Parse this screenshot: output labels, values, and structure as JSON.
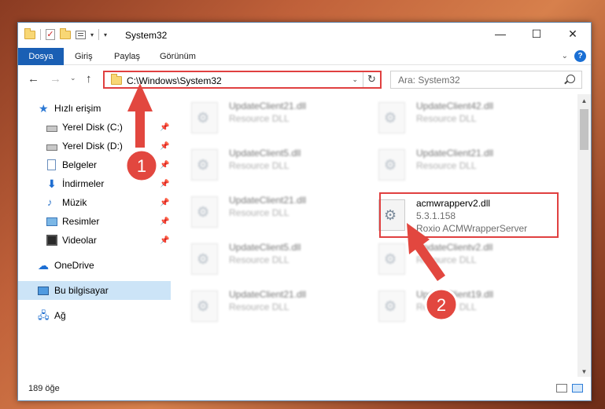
{
  "window": {
    "title": "System32"
  },
  "ribbon": {
    "tabs": [
      "Dosya",
      "Giriş",
      "Paylaş",
      "Görünüm"
    ],
    "help": "?"
  },
  "address": {
    "path": "C:\\Windows\\System32",
    "search_placeholder": "Ara: System32"
  },
  "sidebar": {
    "quick_access": "Hızlı erişim",
    "items": [
      "Yerel Disk (C:)",
      "Yerel Disk (D:)",
      "Belgeler",
      "İndirmeler",
      "Müzik",
      "Resimler",
      "Videolar"
    ],
    "onedrive": "OneDrive",
    "this_pc": "Bu bilgisayar",
    "network": "Ağ"
  },
  "files": [
    {
      "name": "UpdateClient21.dll",
      "desc": "Resource DLL"
    },
    {
      "name": "UpdateClient42.dll",
      "desc": "Resource DLL"
    },
    {
      "name": "UpdateClient5.dll",
      "desc": "Resource DLL"
    },
    {
      "name": "UpdateClient21.dll",
      "desc": "Resource DLL"
    },
    {
      "name": "UpdateClient21.dll",
      "desc": "Resource DLL"
    },
    {
      "name": "acmwrapperv2.dll",
      "version": "5.3.1.158",
      "desc": "Roxio ACMWrapperServer"
    },
    {
      "name": "UpdateClient5.dll",
      "desc": "Resource DLL"
    },
    {
      "name": "UpdateClientv2.dll",
      "desc": "Resource DLL"
    },
    {
      "name": "UpdateClient21.dll",
      "desc": "Resource DLL"
    },
    {
      "name": "UpdateClient19.dll",
      "desc": "Resource DLL"
    }
  ],
  "status": {
    "count": "189 öğe"
  },
  "annotations": {
    "step1": "1",
    "step2": "2",
    "color": "#e2473f"
  },
  "colors": {
    "accent": "#1a5fb4",
    "highlight": "#e04040",
    "selection": "#cce4f7"
  }
}
